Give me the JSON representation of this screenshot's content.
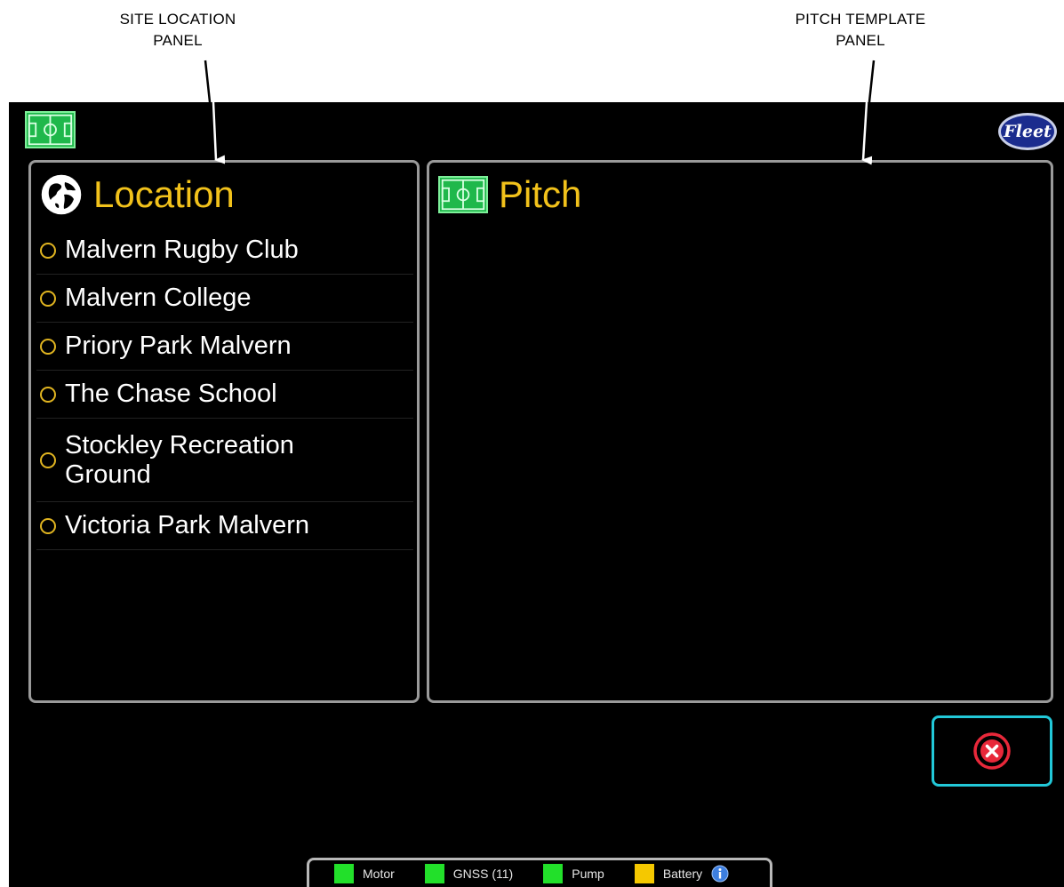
{
  "annotations": {
    "left_line1": "SITE LOCATION",
    "left_line2": "PANEL",
    "right_line1": "PITCH TEMPLATE",
    "right_line2": "PANEL"
  },
  "header": {
    "logo_text": "Fleet"
  },
  "location_panel": {
    "title": "Location",
    "items": [
      {
        "label": "Malvern Rugby Club"
      },
      {
        "label": "Malvern College"
      },
      {
        "label": "Priory Park Malvern"
      },
      {
        "label": "The Chase School"
      },
      {
        "label": "Stockley Recreation Ground"
      },
      {
        "label": "Victoria Park Malvern"
      }
    ]
  },
  "pitch_panel": {
    "title": "Pitch"
  },
  "status_bar": {
    "items": [
      {
        "label": "Motor",
        "color": "#22e02a"
      },
      {
        "label": "GNSS (11)",
        "color": "#22e02a"
      },
      {
        "label": "Pump",
        "color": "#22e02a"
      },
      {
        "label": "Battery",
        "color": "#f5c800"
      }
    ]
  },
  "colors": {
    "accent": "#f2c21b",
    "close_border": "#22c8d8",
    "close_icon": "#e8283a",
    "pitch_green": "#1fb84b"
  },
  "icons": {
    "top": "pitch-icon",
    "logo": "fleet-logo",
    "location": "globe-icon",
    "pitch": "pitch-icon",
    "close": "close-circle-icon",
    "info": "info-icon"
  }
}
